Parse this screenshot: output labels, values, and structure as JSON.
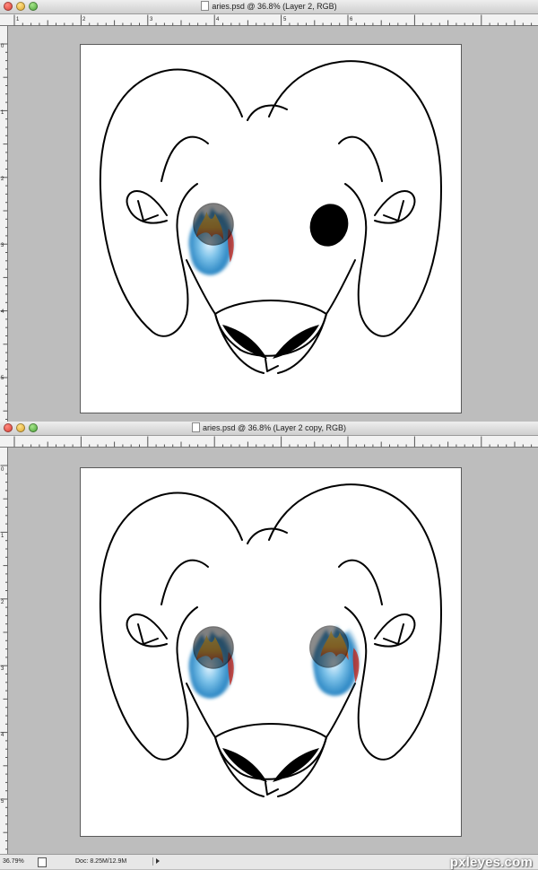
{
  "windows": [
    {
      "title": "aries.psd @ 36.8% (Layer 2, RGB)"
    },
    {
      "title": "aries.psd @ 36.8% (Layer 2 copy, RGB)"
    }
  ],
  "ruler": {
    "h_labels": [
      "1",
      "2",
      "3",
      "4",
      "5",
      "6"
    ],
    "v_labels": [
      "0",
      "1",
      "2",
      "3",
      "4",
      "5"
    ]
  },
  "status": {
    "zoom": "36.79%",
    "doc_size": "Doc: 8.25M/12.9M"
  },
  "watermark": "pxleyes.com",
  "icons": [
    "close-icon",
    "minimize-icon",
    "zoom-icon",
    "document-icon",
    "status-menu-arrow-icon"
  ],
  "colors": {
    "window_bg": "#bdbdbd",
    "canvas": "#ffffff",
    "flame_blue": "#1e88c8",
    "flame_orange": "#f2a21a",
    "flame_red": "#c0281e"
  }
}
